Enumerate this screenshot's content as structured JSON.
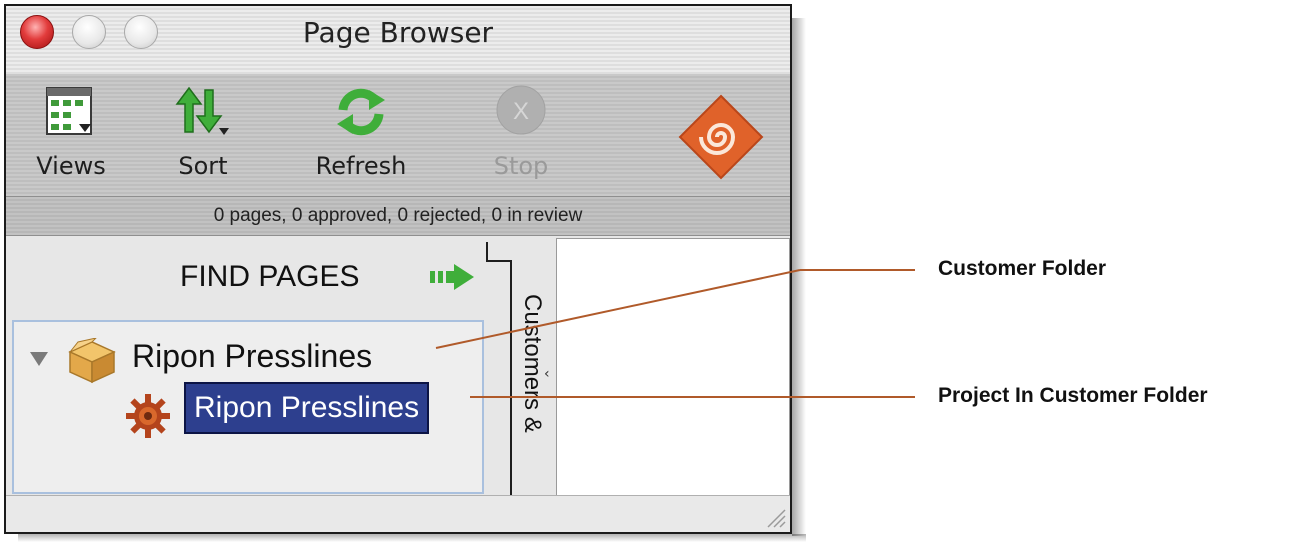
{
  "window": {
    "title": "Page Browser"
  },
  "toolbar": {
    "views_label": "Views",
    "sort_label": "Sort",
    "refresh_label": "Refresh",
    "stop_label": "Stop"
  },
  "status": {
    "text": "0 pages, 0 approved, 0 rejected, 0 in review"
  },
  "browser": {
    "find_pages": "FIND PAGES",
    "customer_name": "Ripon Presslines",
    "project_name": "Ripon Presslines",
    "side_tab": "Customers &"
  },
  "callouts": {
    "customer_folder": "Customer Folder",
    "project_in_customer_folder": "Project In Customer Folder"
  },
  "colors": {
    "selection": "#2d3f8e",
    "callout_line": "#b05a2a",
    "brand_logo": "#e0622a"
  }
}
